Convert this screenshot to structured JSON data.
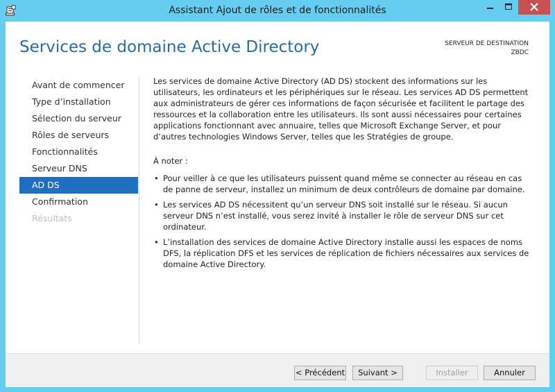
{
  "window": {
    "title": "Assistant Ajout de rôles et de fonctionnalités",
    "controls": {
      "minimize_icon": "minimize-icon",
      "maximize_icon": "maximize-icon",
      "close_icon": "close-icon"
    }
  },
  "header": {
    "page_title": "Services de domaine Active Directory",
    "destination_label": "SERVEUR DE DESTINATION",
    "destination_server": "ZBDC"
  },
  "nav": {
    "items": [
      {
        "label": "Avant de commencer",
        "state": "normal"
      },
      {
        "label": "Type d’installation",
        "state": "normal"
      },
      {
        "label": "Sélection du serveur",
        "state": "normal"
      },
      {
        "label": "Rôles de serveurs",
        "state": "normal"
      },
      {
        "label": "Fonctionnalités",
        "state": "normal"
      },
      {
        "label": "Serveur DNS",
        "state": "normal"
      },
      {
        "label": "AD DS",
        "state": "active"
      },
      {
        "label": "Confirmation",
        "state": "normal"
      },
      {
        "label": "Résultats",
        "state": "disabled"
      }
    ]
  },
  "content": {
    "intro": "Les services de domaine Active Directory (AD DS) stockent des informations sur les utilisateurs, les ordinateurs et les périphériques sur le réseau. Les services AD DS permettent aux administrateurs de gérer ces informations de façon sécurisée et facilitent le partage des ressources et la collaboration entre les utilisateurs. Ils sont aussi nécessaires pour certaines applications fonctionnant avec annuaire, telles que Microsoft Exchange Server, et pour d’autres technologies Windows Server, telles que les Stratégies de groupe.",
    "note_heading": "À noter :",
    "bullet_glyph": "•",
    "bullets": [
      "Pour veiller à ce que les utilisateurs puissent quand même se connecter au réseau en cas de panne de serveur, installez un minimum de deux contrôleurs de domaine par domaine.",
      "Les services AD DS nécessitent qu’un serveur DNS soit installé sur le réseau. Si aucun serveur DNS n’est installé, vous serez invité à installer le rôle de serveur DNS sur cet ordinateur.",
      "L’installation des services de domaine Active Directory installe aussi les espaces de noms DFS, la réplication DFS et les services de réplication de fichiers nécessaires aux services de domaine Active Directory."
    ]
  },
  "footer": {
    "prev_label": "< Précédent",
    "next_label": "Suivant >",
    "install_label": "Installer",
    "cancel_label": "Annuler"
  },
  "colors": {
    "window_frame": "#65cdf0",
    "title_accent": "#2a6aa8",
    "nav_selected": "#1f6fc1",
    "close_button": "#c75050"
  }
}
